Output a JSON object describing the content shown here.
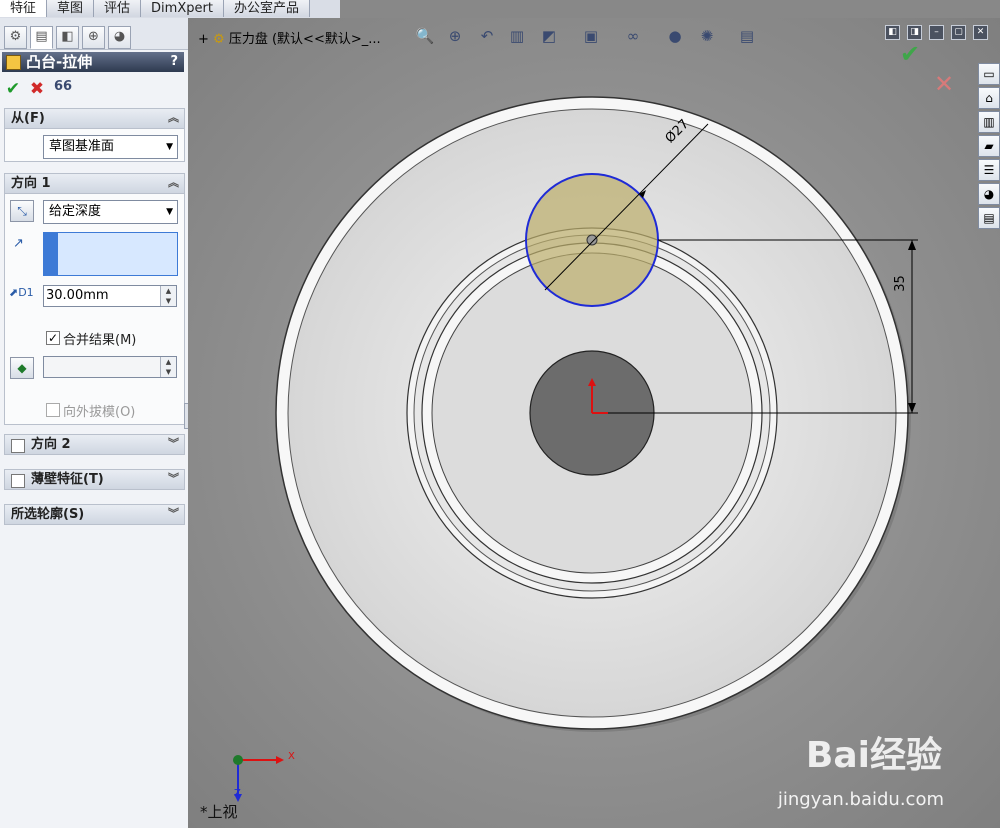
{
  "top_tabs": [
    "特征",
    "草图",
    "评估",
    "DimXpert",
    "办公室产品"
  ],
  "panel": {
    "title": "凸台-拉伸",
    "help": "?",
    "actions": {
      "ok": "✔",
      "cancel": "✖",
      "preview": "66"
    },
    "from": {
      "label": "从(F)",
      "value": "草图基准面"
    },
    "direction1": {
      "label": "方向 1",
      "end_condition": "给定深度",
      "depth": "30.00mm",
      "merge_label": "合并结果(M)",
      "merge_checked": true,
      "draft_outward_label": "向外拔模(O)"
    },
    "direction2_label": "方向 2",
    "thin_feature_label": "薄壁特征(T)",
    "selected_contours_label": "所选轮廓(S)"
  },
  "viewport": {
    "breadcrumb": "压力盘 (默认<<默认>_...",
    "dimensions": {
      "diameter": "Ø27",
      "vertical": "35"
    },
    "axis_labels": {
      "x": "X",
      "z": "Z"
    },
    "view_name": "*上视",
    "watermark": {
      "brand": "Bai经验",
      "url": "jingyan.baidu.com"
    }
  },
  "colors": {
    "accent": "#2e3a50",
    "profile_blue": "#1f2bd6",
    "preview_fill": "#bcae6b",
    "ok_green": "#1e9a2b",
    "cancel_red": "#d12a2a"
  }
}
